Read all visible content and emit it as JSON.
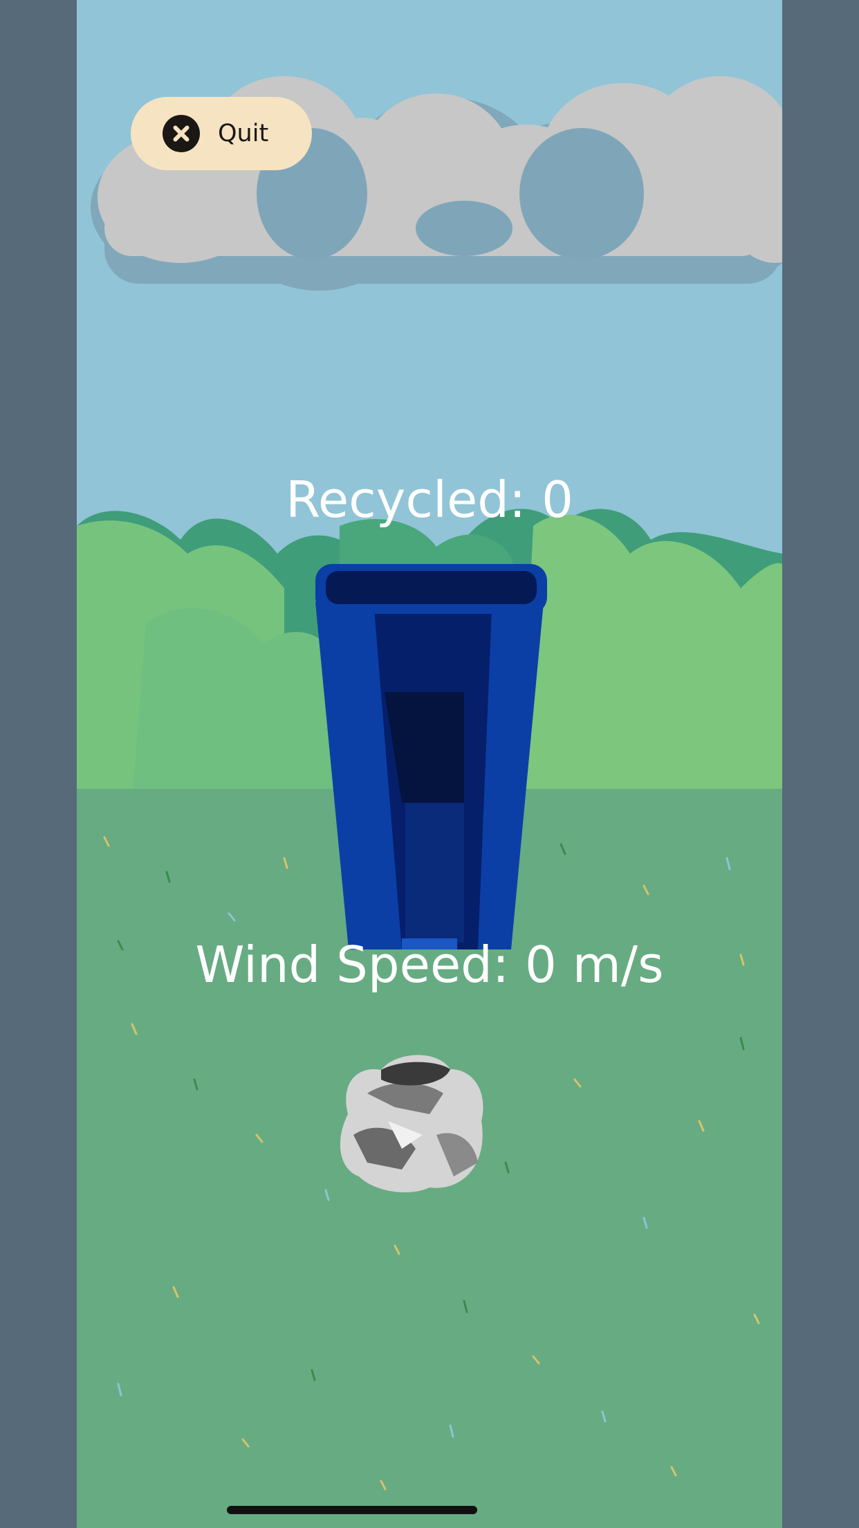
{
  "quit_button": {
    "label": "Quit",
    "icon": "close-icon"
  },
  "hud": {
    "recycled_label": "Recycled:",
    "recycled_count": 0,
    "recycled_text": "Recycled: 0",
    "wind_label": "Wind Speed:",
    "wind_value": 0,
    "wind_unit": "m/s",
    "wind_text": "Wind Speed: 0 m/s"
  },
  "scene": {
    "sky_color": "#91c4d6",
    "cloud_color": "#c7c7c7",
    "bush_color": "#6fbf80",
    "grass_color": "#67ab82",
    "bin_color": "#0a3fa8",
    "paper_ball_color": "#d4d4d4"
  }
}
